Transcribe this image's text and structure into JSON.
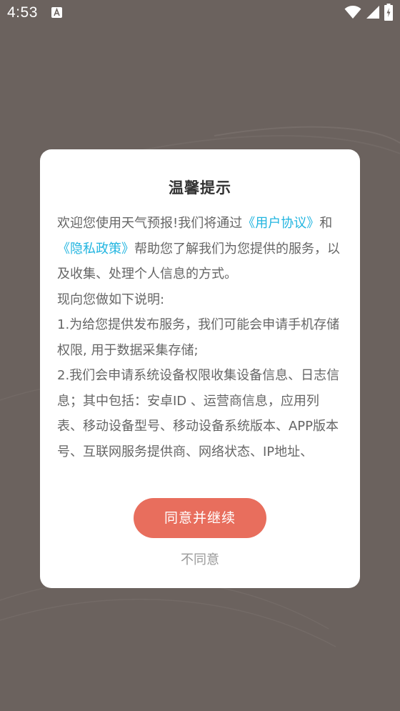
{
  "status_bar": {
    "time": "4:53"
  },
  "dialog": {
    "title": "温馨提示",
    "intro_prefix": "欢迎您使用天气预报!我们将通过",
    "user_agreement": "《用户协议》",
    "and": "和",
    "privacy_policy": "《隐私政策》",
    "intro_suffix": "帮助您了解我们为您提供的服务，以及收集、处理个人信息的方式。",
    "explain_heading": "现向您做如下说明:",
    "item_1": "1.为给您提供发布服务，我们可能会申请手机存储权限, 用于数据采集存储;",
    "item_2": "2.我们会申请系统设备权限收集设备信息、日志信息；其中包括：安卓ID 、运营商信息，应用列表、移动设备型号、移动设备系统版本、APP版本号、互联网服务提供商、网络状态、IP地址、",
    "agree_label": "同意并继续",
    "disagree_label": "不同意"
  },
  "colors": {
    "overlay_background": "#6b625e",
    "link": "#22b5e0",
    "agree_button": "#e86e5d",
    "disagree_text": "#999999"
  },
  "icons": [
    "notification-a-icon",
    "wifi-icon",
    "cellular-signal-icon",
    "battery-icon"
  ]
}
